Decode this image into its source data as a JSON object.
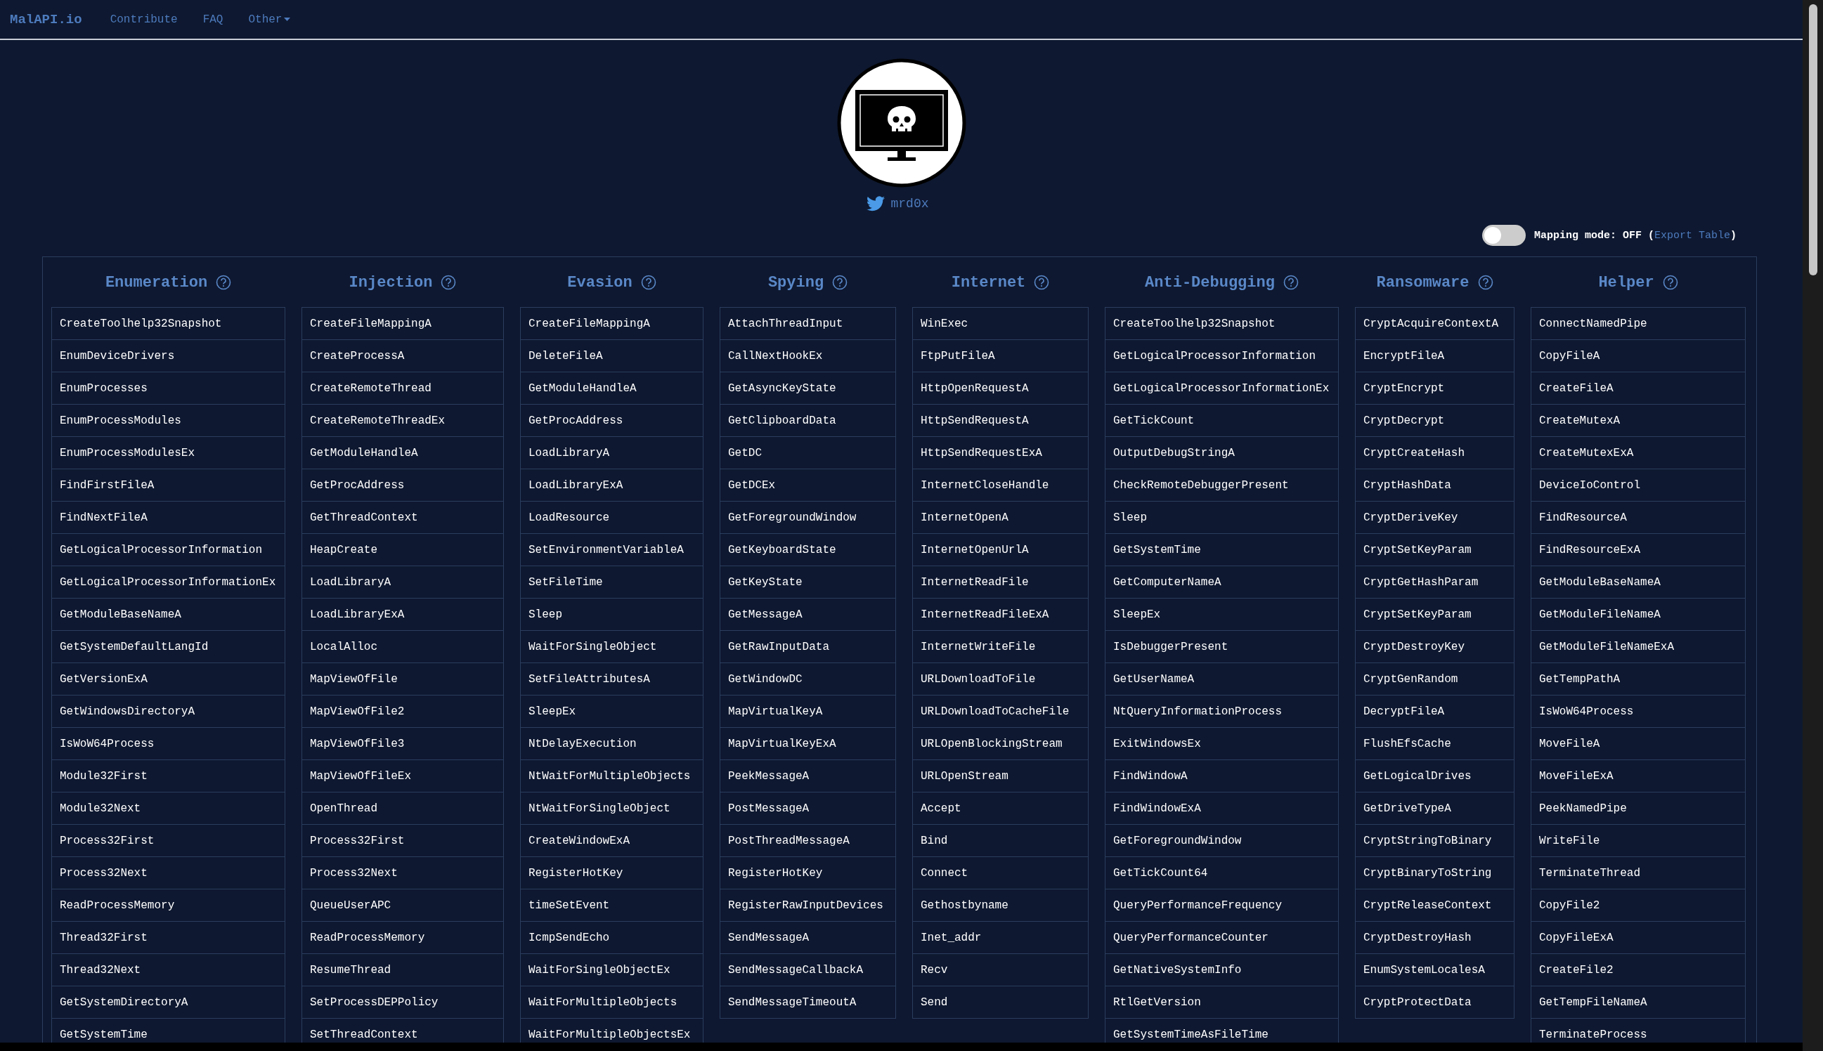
{
  "nav": {
    "brand": "MalAPI.io",
    "links": [
      "Contribute",
      "FAQ"
    ],
    "menu": "Other"
  },
  "profile": {
    "handle": "mrd0x"
  },
  "mapping_mode": {
    "on": false,
    "before_link": "Mapping mode: OFF (",
    "link": "Export Table",
    "after_link": ")"
  },
  "categories": [
    {
      "title": "Enumeration",
      "items": [
        "CreateToolhelp32Snapshot",
        "EnumDeviceDrivers",
        "EnumProcesses",
        "EnumProcessModules",
        "EnumProcessModulesEx",
        "FindFirstFileA",
        "FindNextFileA",
        "GetLogicalProcessorInformation",
        "GetLogicalProcessorInformationEx",
        "GetModuleBaseNameA",
        "GetSystemDefaultLangId",
        "GetVersionExA",
        "GetWindowsDirectoryA",
        "IsWoW64Process",
        "Module32First",
        "Module32Next",
        "Process32First",
        "Process32Next",
        "ReadProcessMemory",
        "Thread32First",
        "Thread32Next",
        "GetSystemDirectoryA",
        "GetSystemTime"
      ]
    },
    {
      "title": "Injection",
      "items": [
        "CreateFileMappingA",
        "CreateProcessA",
        "CreateRemoteThread",
        "CreateRemoteThreadEx",
        "GetModuleHandleA",
        "GetProcAddress",
        "GetThreadContext",
        "HeapCreate",
        "LoadLibraryA",
        "LoadLibraryExA",
        "LocalAlloc",
        "MapViewOfFile",
        "MapViewOfFile2",
        "MapViewOfFile3",
        "MapViewOfFileEx",
        "OpenThread",
        "Process32First",
        "Process32Next",
        "QueueUserAPC",
        "ReadProcessMemory",
        "ResumeThread",
        "SetProcessDEPPolicy",
        "SetThreadContext"
      ]
    },
    {
      "title": "Evasion",
      "items": [
        "CreateFileMappingA",
        "DeleteFileA",
        "GetModuleHandleA",
        "GetProcAddress",
        "LoadLibraryA",
        "LoadLibraryExA",
        "LoadResource",
        "SetEnvironmentVariableA",
        "SetFileTime",
        "Sleep",
        "WaitForSingleObject",
        "SetFileAttributesA",
        "SleepEx",
        "NtDelayExecution",
        "NtWaitForMultipleObjects",
        "NtWaitForSingleObject",
        "CreateWindowExA",
        "RegisterHotKey",
        "timeSetEvent",
        "IcmpSendEcho",
        "WaitForSingleObjectEx",
        "WaitForMultipleObjects",
        "WaitForMultipleObjectsEx"
      ]
    },
    {
      "title": "Spying",
      "items": [
        "AttachThreadInput",
        "CallNextHookEx",
        "GetAsyncKeyState",
        "GetClipboardData",
        "GetDC",
        "GetDCEx",
        "GetForegroundWindow",
        "GetKeyboardState",
        "GetKeyState",
        "GetMessageA",
        "GetRawInputData",
        "GetWindowDC",
        "MapVirtualKeyA",
        "MapVirtualKeyExA",
        "PeekMessageA",
        "PostMessageA",
        "PostThreadMessageA",
        "RegisterHotKey",
        "RegisterRawInputDevices",
        "SendMessageA",
        "SendMessageCallbackA",
        "SendMessageTimeoutA"
      ]
    },
    {
      "title": "Internet",
      "items": [
        "WinExec",
        "FtpPutFileA",
        "HttpOpenRequestA",
        "HttpSendRequestA",
        "HttpSendRequestExA",
        "InternetCloseHandle",
        "InternetOpenA",
        "InternetOpenUrlA",
        "InternetReadFile",
        "InternetReadFileExA",
        "InternetWriteFile",
        "URLDownloadToFile",
        "URLDownloadToCacheFile",
        "URLOpenBlockingStream",
        "URLOpenStream",
        "Accept",
        "Bind",
        "Connect",
        "Gethostbyname",
        "Inet_addr",
        "Recv",
        "Send"
      ]
    },
    {
      "title": "Anti-Debugging",
      "items": [
        "CreateToolhelp32Snapshot",
        "GetLogicalProcessorInformation",
        "GetLogicalProcessorInformationEx",
        "GetTickCount",
        "OutputDebugStringA",
        "CheckRemoteDebuggerPresent",
        "Sleep",
        "GetSystemTime",
        "GetComputerNameA",
        "SleepEx",
        "IsDebuggerPresent",
        "GetUserNameA",
        "NtQueryInformationProcess",
        "ExitWindowsEx",
        "FindWindowA",
        "FindWindowExA",
        "GetForegroundWindow",
        "GetTickCount64",
        "QueryPerformanceFrequency",
        "QueryPerformanceCounter",
        "GetNativeSystemInfo",
        "RtlGetVersion",
        "GetSystemTimeAsFileTime"
      ]
    },
    {
      "title": "Ransomware",
      "items": [
        "CryptAcquireContextA",
        "EncryptFileA",
        "CryptEncrypt",
        "CryptDecrypt",
        "CryptCreateHash",
        "CryptHashData",
        "CryptDeriveKey",
        "CryptSetKeyParam",
        "CryptGetHashParam",
        "CryptSetKeyParam",
        "CryptDestroyKey",
        "CryptGenRandom",
        "DecryptFileA",
        "FlushEfsCache",
        "GetLogicalDrives",
        "GetDriveTypeA",
        "CryptStringToBinary",
        "CryptBinaryToString",
        "CryptReleaseContext",
        "CryptDestroyHash",
        "EnumSystemLocalesA",
        "CryptProtectData"
      ]
    },
    {
      "title": "Helper",
      "items": [
        "ConnectNamedPipe",
        "CopyFileA",
        "CreateFileA",
        "CreateMutexA",
        "CreateMutexExA",
        "DeviceIoControl",
        "FindResourceA",
        "FindResourceExA",
        "GetModuleBaseNameA",
        "GetModuleFileNameA",
        "GetModuleFileNameExA",
        "GetTempPathA",
        "IsWoW64Process",
        "MoveFileA",
        "MoveFileExA",
        "PeekNamedPipe",
        "WriteFile",
        "TerminateThread",
        "CopyFile2",
        "CopyFileExA",
        "CreateFile2",
        "GetTempFileNameA",
        "TerminateProcess"
      ]
    }
  ]
}
